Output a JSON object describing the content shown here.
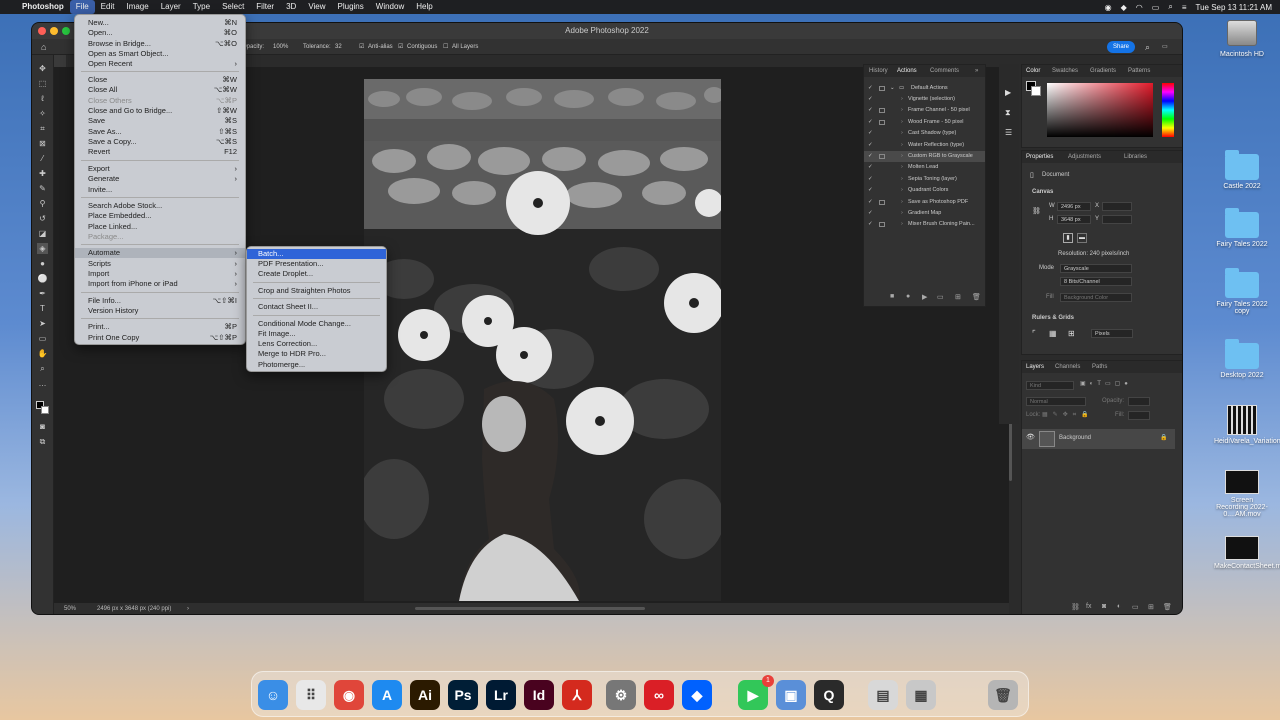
{
  "menubar": {
    "app": "Photoshop",
    "items": [
      "File",
      "Edit",
      "Image",
      "Layer",
      "Type",
      "Select",
      "Filter",
      "3D",
      "View",
      "Plugins",
      "Window",
      "Help"
    ],
    "clock": "Tue Sep 13  11:21 AM"
  },
  "window": {
    "title": "Adobe Photoshop 2022",
    "share_label": "Share"
  },
  "options": {
    "opacity_label": "Opacity:",
    "opacity_value": "100%",
    "tolerance_label": "Tolerance:",
    "tolerance_value": "32",
    "antialias": "Anti-alias",
    "contiguous": "Contiguous",
    "all_layers": "All Layers"
  },
  "status": {
    "zoom": "50%",
    "info": "2496 px x 3648 px (240 ppi)"
  },
  "file_menu": {
    "items": [
      {
        "label": "New...",
        "shortcut": "⌘N"
      },
      {
        "label": "Open...",
        "shortcut": "⌘O"
      },
      {
        "label": "Browse in Bridge...",
        "shortcut": "⌥⌘O"
      },
      {
        "label": "Open as Smart Object...",
        "shortcut": ""
      },
      {
        "label": "Open Recent",
        "shortcut": "›"
      },
      {
        "label": "Close",
        "shortcut": "⌘W"
      },
      {
        "label": "Close All",
        "shortcut": "⌥⌘W"
      },
      {
        "label": "Close Others",
        "shortcut": "⌥⌘P"
      },
      {
        "label": "Close and Go to Bridge...",
        "shortcut": "⇧⌘W"
      },
      {
        "label": "Save",
        "shortcut": "⌘S"
      },
      {
        "label": "Save As...",
        "shortcut": "⇧⌘S"
      },
      {
        "label": "Save a Copy...",
        "shortcut": "⌥⌘S"
      },
      {
        "label": "Revert",
        "shortcut": "F12"
      },
      {
        "label": "Export",
        "shortcut": "›"
      },
      {
        "label": "Generate",
        "shortcut": "›"
      },
      {
        "label": "Invite...",
        "shortcut": ""
      },
      {
        "label": "Search Adobe Stock...",
        "shortcut": ""
      },
      {
        "label": "Place Embedded...",
        "shortcut": ""
      },
      {
        "label": "Place Linked...",
        "shortcut": ""
      },
      {
        "label": "Package...",
        "shortcut": ""
      },
      {
        "label": "Automate",
        "shortcut": "›"
      },
      {
        "label": "Scripts",
        "shortcut": "›"
      },
      {
        "label": "Import",
        "shortcut": "›"
      },
      {
        "label": "Import from iPhone or iPad",
        "shortcut": "›"
      },
      {
        "label": "File Info...",
        "shortcut": "⌥⇧⌘I"
      },
      {
        "label": "Version History",
        "shortcut": ""
      },
      {
        "label": "Print...",
        "shortcut": "⌘P"
      },
      {
        "label": "Print One Copy",
        "shortcut": "⌥⇧⌘P"
      }
    ]
  },
  "automate_menu": {
    "items": [
      "Batch...",
      "PDF Presentation...",
      "Create Droplet...",
      "Crop and Straighten Photos",
      "Contact Sheet II...",
      "Conditional Mode Change...",
      "Fit Image...",
      "Lens Correction...",
      "Merge to HDR Pro...",
      "Photomerge..."
    ]
  },
  "actions_panel": {
    "tabs": [
      "History",
      "Actions",
      "Comments"
    ],
    "set": "Default Actions",
    "items": [
      "Vignette (selection)",
      "Frame Channel - 50 pixel",
      "Wood Frame - 50 pixel",
      "Cast Shadow (type)",
      "Water Reflection (type)",
      "Custom RGB to Grayscale",
      "Molten Lead",
      "Sepia Toning (layer)",
      "Quadrant Colors",
      "Save as Photoshop PDF",
      "Gradient Map",
      "Mixer Brush Cloning Pain..."
    ]
  },
  "color_panel": {
    "tabs": [
      "Color",
      "Swatches",
      "Gradients",
      "Patterns"
    ]
  },
  "properties_panel": {
    "tabs": [
      "Properties",
      "Adjustments",
      "Libraries"
    ],
    "document": "Document",
    "canvas_title": "Canvas",
    "w_label": "W",
    "w_value": "2496 px",
    "h_label": "H",
    "h_value": "3648 px",
    "x_label": "X",
    "y_label": "Y",
    "resolution": "Resolution: 240 pixels/inch",
    "mode_label": "Mode",
    "mode_value": "Grayscale",
    "bits_value": "8 Bits/Channel",
    "fill_label": "Fill",
    "fill_value": "Background Color",
    "rulers_title": "Rulers & Grids",
    "units_value": "Pixels"
  },
  "layers_panel": {
    "tabs": [
      "Layers",
      "Channels",
      "Paths"
    ],
    "kind_placeholder": "Kind",
    "blend": "Normal",
    "opacity_label": "Opacity:",
    "lock_label": "Lock:",
    "fill_label": "Fill:",
    "layer_name": "Background"
  },
  "desktop": {
    "icons": [
      {
        "label": "Macintosh HD",
        "kind": "drive-icon"
      },
      {
        "label": "Castle 2022",
        "kind": "folder-icon"
      },
      {
        "label": "Fairy Tales 2022",
        "kind": "folder-icon"
      },
      {
        "label": "Fairy Tales 2022 copy",
        "kind": "folder-icon"
      },
      {
        "label": "Desktop 2022",
        "kind": "folder-icon"
      },
      {
        "label": "HeidiVarela_Variations_MM...YYY.jpg",
        "kind": "image-file-icon"
      },
      {
        "label": "Screen Recording 2022-0....AM.mov",
        "kind": "video-file-icon"
      },
      {
        "label": "MakeContactSheet.mov",
        "kind": "video-file-icon"
      }
    ]
  },
  "dock": {
    "apps": [
      {
        "name": "Finder",
        "glyph": "☺",
        "color": "#3a8ee6"
      },
      {
        "name": "Launchpad",
        "glyph": "⠿",
        "color": "#e8e8e8"
      },
      {
        "name": "Chrome",
        "glyph": "◉",
        "color": "#e0463a"
      },
      {
        "name": "App Store",
        "glyph": "A",
        "color": "#1e8af0"
      },
      {
        "name": "Illustrator",
        "glyph": "Ai",
        "color": "#2b1a00"
      },
      {
        "name": "Photoshop",
        "glyph": "Ps",
        "color": "#001e36"
      },
      {
        "name": "Lightroom",
        "glyph": "Lr",
        "color": "#001a33"
      },
      {
        "name": "InDesign",
        "glyph": "Id",
        "color": "#49021f"
      },
      {
        "name": "Acrobat",
        "glyph": "⅄",
        "color": "#d42a1e"
      },
      {
        "name": "System Preferences",
        "glyph": "⚙",
        "color": "#777"
      },
      {
        "name": "Creative Cloud",
        "glyph": "∞",
        "color": "#da1f26"
      },
      {
        "name": "Dropbox",
        "glyph": "◆",
        "color": "#0061fe"
      },
      {
        "name": "FaceTime",
        "glyph": "▶",
        "color": "#32c759"
      },
      {
        "name": "Preview",
        "glyph": "▣",
        "color": "#5a8fd8"
      },
      {
        "name": "QuickTime",
        "glyph": "Q",
        "color": "#2a2a2a"
      },
      {
        "name": "Documents",
        "glyph": "▤",
        "color": "#d8d8d8"
      },
      {
        "name": "Recent Items",
        "glyph": "▦",
        "color": "#c8c8c8"
      },
      {
        "name": "Trash",
        "glyph": "🗑",
        "color": "#b5b5b5"
      }
    ],
    "facetime_badge": "1"
  }
}
